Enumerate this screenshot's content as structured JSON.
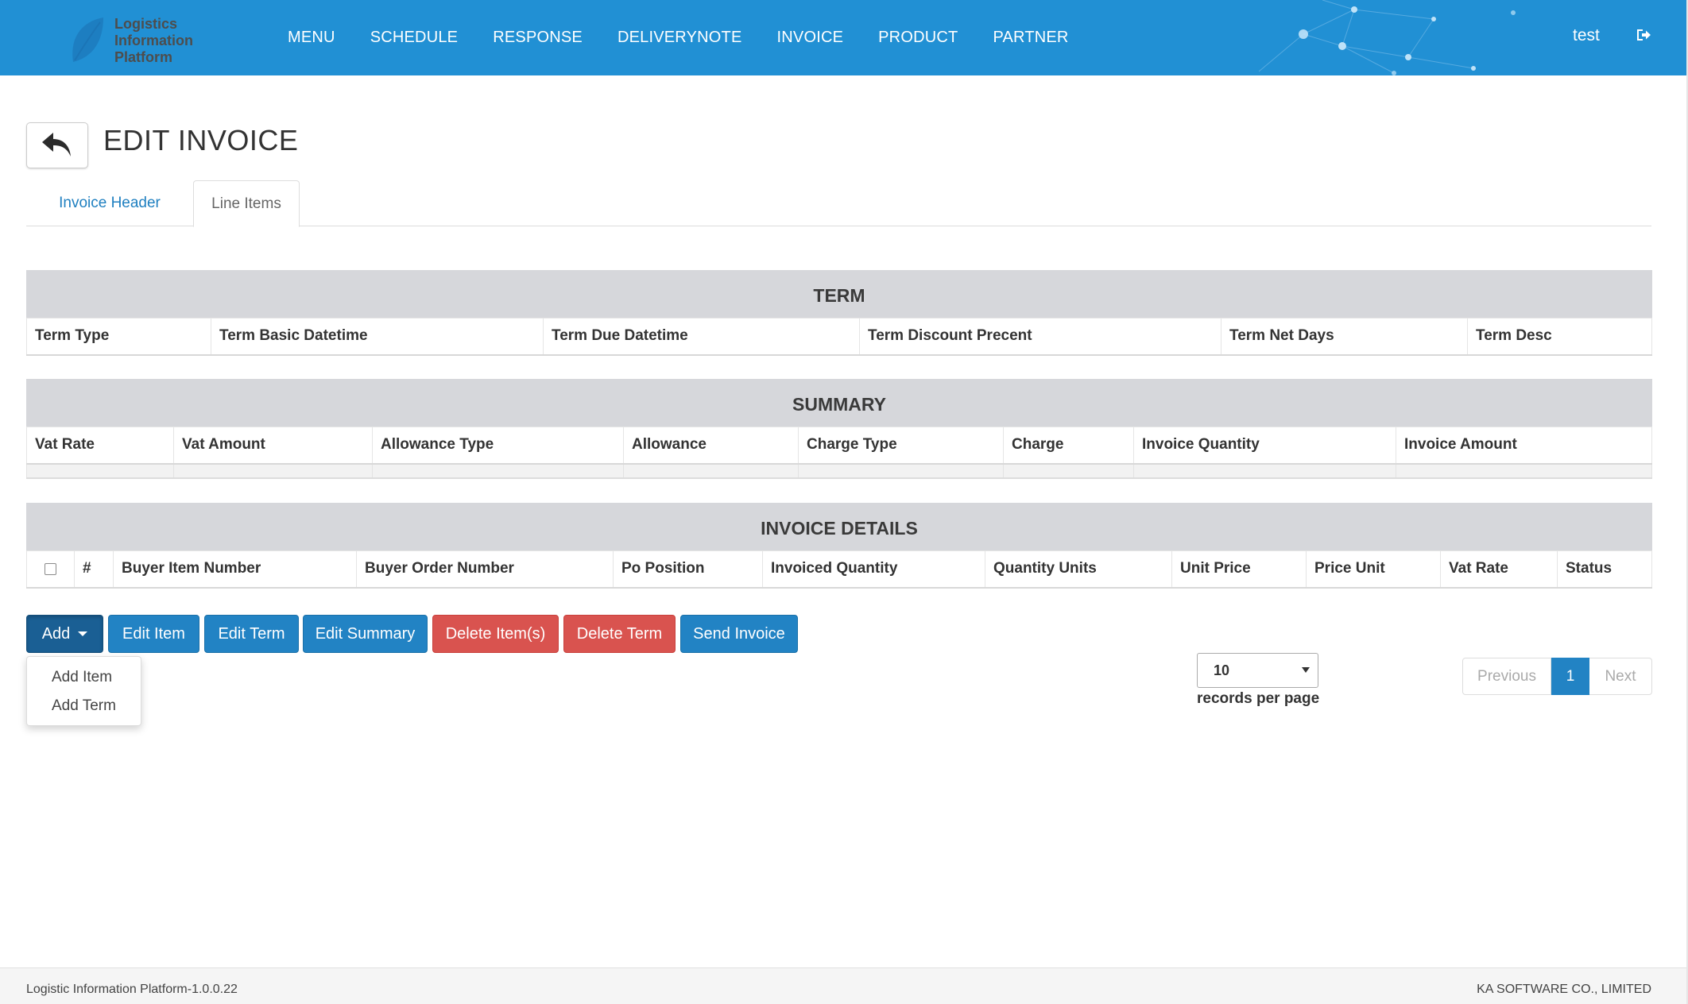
{
  "brand": {
    "line1": "Logistics",
    "line2": "Information",
    "line3": "Platform"
  },
  "nav": {
    "items": [
      "MENU",
      "SCHEDULE",
      "RESPONSE",
      "DELIVERYNOTE",
      "INVOICE",
      "PRODUCT",
      "PARTNER"
    ],
    "user": "test"
  },
  "page": {
    "title": "EDIT INVOICE"
  },
  "tabs": [
    {
      "label": "Invoice Header",
      "active": false
    },
    {
      "label": "Line Items",
      "active": true
    }
  ],
  "term_table": {
    "caption": "TERM",
    "columns": [
      "Term Type",
      "Term Basic Datetime",
      "Term Due Datetime",
      "Term Discount Precent",
      "Term Net Days",
      "Term Desc"
    ]
  },
  "summary_table": {
    "caption": "SUMMARY",
    "columns": [
      "Vat Rate",
      "Vat Amount",
      "Allowance Type",
      "Allowance",
      "Charge Type",
      "Charge",
      "Invoice Quantity",
      "Invoice Amount"
    ]
  },
  "details_table": {
    "caption": "INVOICE DETAILS",
    "columns": [
      "#",
      "Buyer Item Number",
      "Buyer Order Number",
      "Po Position",
      "Invoiced Quantity",
      "Quantity Units",
      "Unit Price",
      "Price Unit",
      "Vat Rate",
      "Status"
    ]
  },
  "actions": {
    "add": "Add",
    "edit_item": "Edit Item",
    "edit_term": "Edit Term",
    "edit_summary": "Edit Summary",
    "delete_items": "Delete Item(s)",
    "delete_term": "Delete Term",
    "send_invoice": "Send Invoice"
  },
  "add_menu": {
    "items": [
      "Add Item",
      "Add Term"
    ]
  },
  "pagination": {
    "page_size": "10",
    "page_size_label": "records per page",
    "previous": "Previous",
    "current": "1",
    "next": "Next"
  },
  "footer": {
    "left": "Logistic Information Platform-1.0.0.22",
    "right": "KA SOFTWARE CO., LIMITED"
  },
  "colors": {
    "navbar": "#2190d4",
    "primary": "#2283c4",
    "danger": "#d9534f",
    "table_caption_bg": "#d6d7db"
  }
}
